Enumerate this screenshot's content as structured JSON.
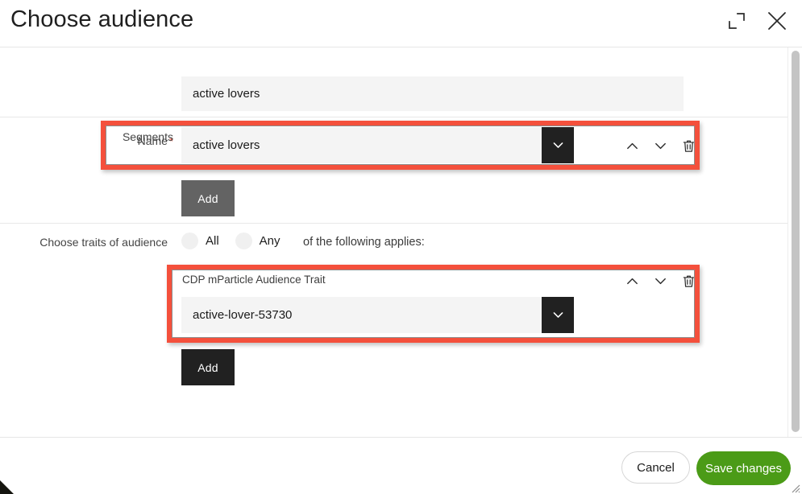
{
  "header": {
    "title": "Choose audience",
    "expand_icon": "expand-icon",
    "close_icon": "close-icon"
  },
  "form": {
    "name_row": {
      "label": "Name",
      "required_mark": "*",
      "value": "active lovers",
      "placeholder": ""
    },
    "segments_row": {
      "label": "Segments",
      "value": "active lovers",
      "placeholder": "",
      "dropdown_icon": "chevron-down-icon",
      "move_up_icon": "chevron-up-icon",
      "move_down_icon": "chevron-down-icon",
      "delete_icon": "trash-icon"
    },
    "segments_add_label": "Add",
    "traits": {
      "label": "Choose traits of audience",
      "options": [
        {
          "label": "All",
          "selected": false
        },
        {
          "label": "Any",
          "selected": false
        }
      ],
      "applies_text": "of the following applies:",
      "trait_card": {
        "title": "CDP mParticle Audience Trait",
        "value": "active-lover-53730",
        "placeholder": "",
        "dropdown_icon": "chevron-down-icon",
        "move_up_icon": "chevron-up-icon",
        "move_down_icon": "chevron-down-icon",
        "delete_icon": "trash-icon"
      }
    },
    "traits_add_label": "Add"
  },
  "footer": {
    "cancel_label": "Cancel",
    "save_label": "Save changes"
  },
  "colors": {
    "annotation": "#f4503c",
    "save_button": "#4b9b17",
    "add_button_gray": "#636363",
    "add_button_black": "#212121",
    "field_background": "#f4f4f4",
    "required_star": "#f4503c"
  },
  "scrollbar": {
    "orientation": "vertical"
  }
}
